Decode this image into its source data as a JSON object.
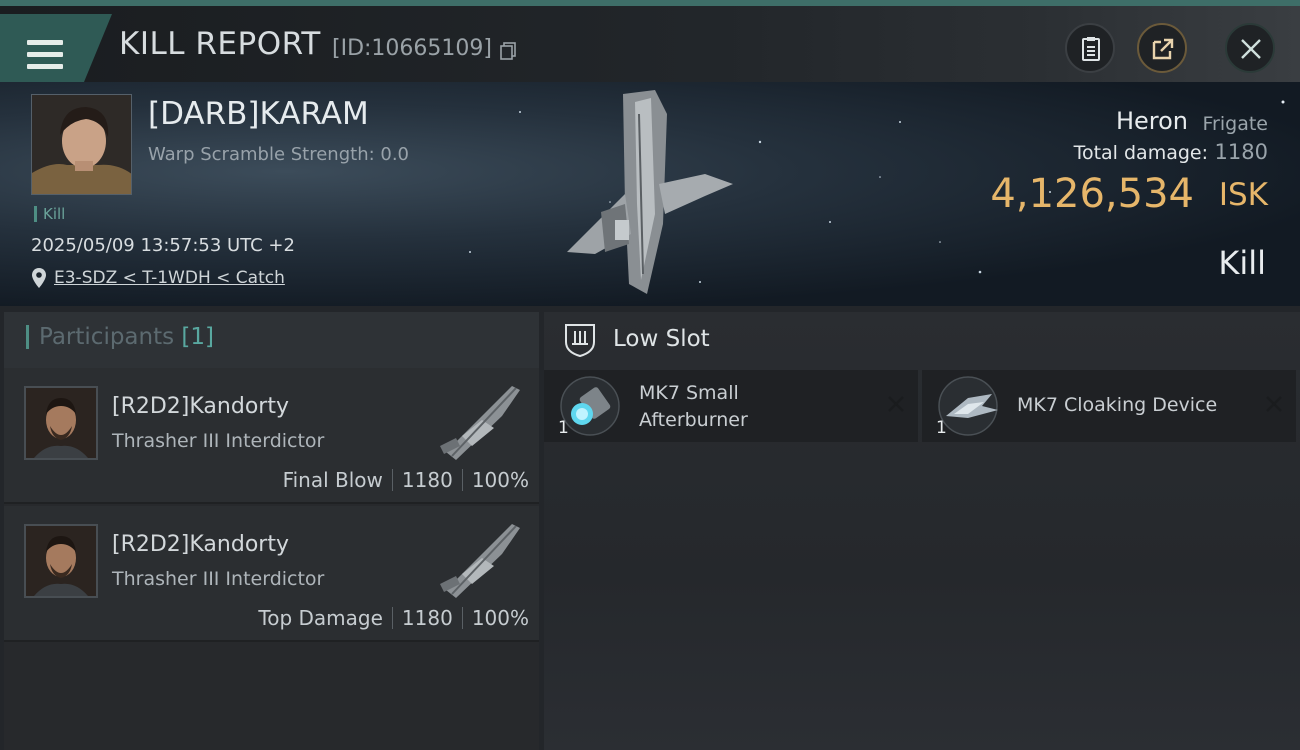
{
  "header": {
    "title": "KILL REPORT",
    "report_id": "[ID:10665109]"
  },
  "victim": {
    "name": "[DARB]KARAM",
    "warp_scramble": "Warp Scramble Strength: 0.0",
    "type_tag": "Kill",
    "datetime": "2025/05/09 13:57:53 UTC +2",
    "location": "E3-SDZ < T-1WDH < Catch",
    "ship_name": "Heron",
    "ship_class": "Frigate",
    "total_damage_label": "Total damage:",
    "total_damage": "1180",
    "isk_value": "4,126,534",
    "isk_unit": "ISK",
    "result": "Kill"
  },
  "participants": {
    "title": "Participants",
    "count": "[1]",
    "rows": [
      {
        "name": "[R2D2]Kandorty",
        "ship": "Thrasher III Interdictor",
        "role": "Final Blow",
        "damage": "1180",
        "percent": "100%"
      },
      {
        "name": "[R2D2]Kandorty",
        "ship": "Thrasher III Interdictor",
        "role": "Top Damage",
        "damage": "1180",
        "percent": "100%"
      }
    ]
  },
  "low_slot": {
    "title": "Low Slot",
    "modules": [
      {
        "name_line1": "MK7 Small",
        "name_line2": "Afterburner",
        "qty": "1"
      },
      {
        "name_line1": "MK7 Cloaking Device",
        "qty": "1"
      }
    ]
  },
  "colors": {
    "accent_teal": "#4e8e84",
    "isk_gold": "#e6b66a",
    "menu_tab": "#2f5a55"
  },
  "icons": [
    "menu-icon",
    "copy-icon",
    "clipboard-icon",
    "share-icon",
    "close-icon",
    "location-pin-icon",
    "low-slot-icon",
    "remove-icon"
  ]
}
